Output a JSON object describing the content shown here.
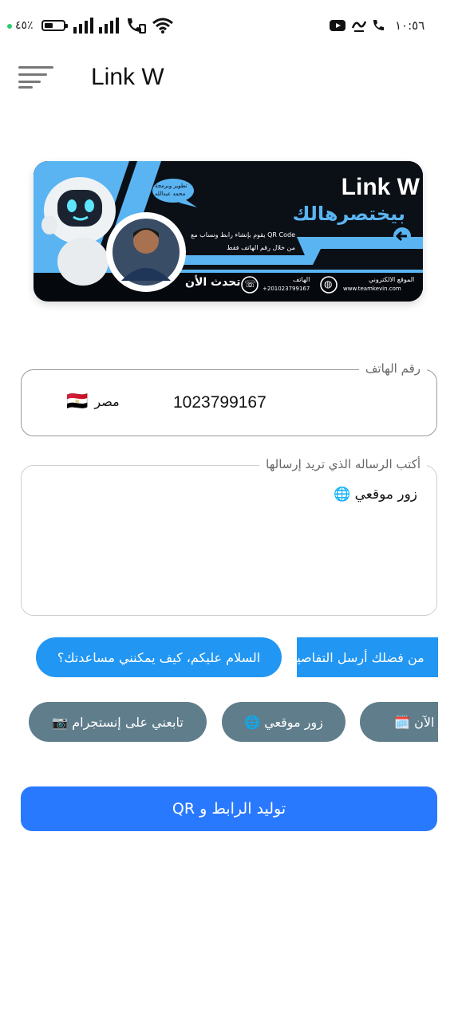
{
  "status_bar": {
    "battery_text": "٤٥٪",
    "time": "١٠:٥٦",
    "battery_level": 0.45
  },
  "app_bar": {
    "title": "Link W"
  },
  "banner": {
    "brand": "Link W",
    "tagline": "بيختصرهالك",
    "description_line1": "يقوم بإنشاء رابط ونساب مع QR Code",
    "description_line2": "من خلال رقم الهاتف فقط",
    "bubble_line1": "تطوير وبرمجة",
    "bubble_line2": "محمد عبدالله",
    "call_now": "تحدث الأن",
    "phone_label": "الهاتف",
    "phone_value": "+201023799167",
    "website_label": "الموقع الالكتروني",
    "website_value": "www.teamkevin.com"
  },
  "phone_field": {
    "label": "رقم الهاتف",
    "country": "مصر",
    "country_flag": "🇪🇬",
    "value": "1023799167"
  },
  "message_field": {
    "label": "أكتب الرساله الذي تريد إرسالها",
    "value": "زور موقعي 🌐"
  },
  "quick_replies_row1": [
    {
      "label": "السلام عليكم، كيف يمكنني مساعدتك؟"
    },
    {
      "label": "من فضلك أرسل التفاصيل."
    }
  ],
  "quick_replies_row2": [
    {
      "label": "تابعني على إنستجرام 📷"
    },
    {
      "label": "زور موقعي 🌐"
    },
    {
      "label": "احجز الآن 🗓️"
    }
  ],
  "generate_button": {
    "label": "توليد الرابط  و  QR"
  },
  "colors": {
    "primary": "#2979ff",
    "chip_blue": "#2196f3",
    "chip_gray": "#607d8b",
    "banner_accent": "#5ab4f2"
  }
}
